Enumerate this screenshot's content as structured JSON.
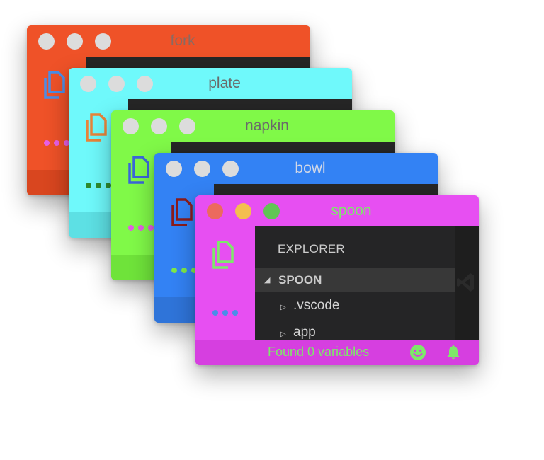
{
  "windows": [
    {
      "title": "fork",
      "bg": "#ef5228",
      "status_bg": "#d9461f",
      "title_color": "#8a6a62",
      "icon_color": "#4a8ee8",
      "dots_color": "#e860e8"
    },
    {
      "title": "plate",
      "bg": "#6ff9fb",
      "status_bg": "#5de0e4",
      "title_color": "#6a6a6a",
      "icon_color": "#e8843a",
      "dots_color": "#2e8b2e"
    },
    {
      "title": "napkin",
      "bg": "#80f948",
      "status_bg": "#6fe33a",
      "title_color": "#6a6a6a",
      "icon_color": "#3b66d9",
      "dots_color": "#e060e0"
    },
    {
      "title": "bowl",
      "bg": "#3382f4",
      "status_bg": "#2f74d9",
      "title_color": "#d2d8e6",
      "icon_color": "#8a1c1c",
      "dots_color": "#7ee84a"
    },
    {
      "title": "spoon",
      "bg": "#e74ff2",
      "status_bg": "#d63fe0",
      "title_color": "#7ee86a",
      "icon_color": "#7ee86a",
      "dots_color": "#4a8ee8"
    }
  ],
  "traffic_lights": {
    "close": "#ec6a5e",
    "minimize": "#f4bf4f",
    "maximize": "#61c554",
    "inactive": "#dcdcdc"
  },
  "explorer": {
    "title": "EXPLORER",
    "section": "SPOON",
    "items": [
      {
        "name": ".vscode"
      },
      {
        "name": "app"
      }
    ]
  },
  "status": {
    "text": "Found 0 variables",
    "color": "#7ee86a"
  },
  "icons": {
    "files": "files-icon",
    "smiley": "smiley-icon",
    "bell": "bell-icon",
    "more": "more-dots-icon"
  }
}
